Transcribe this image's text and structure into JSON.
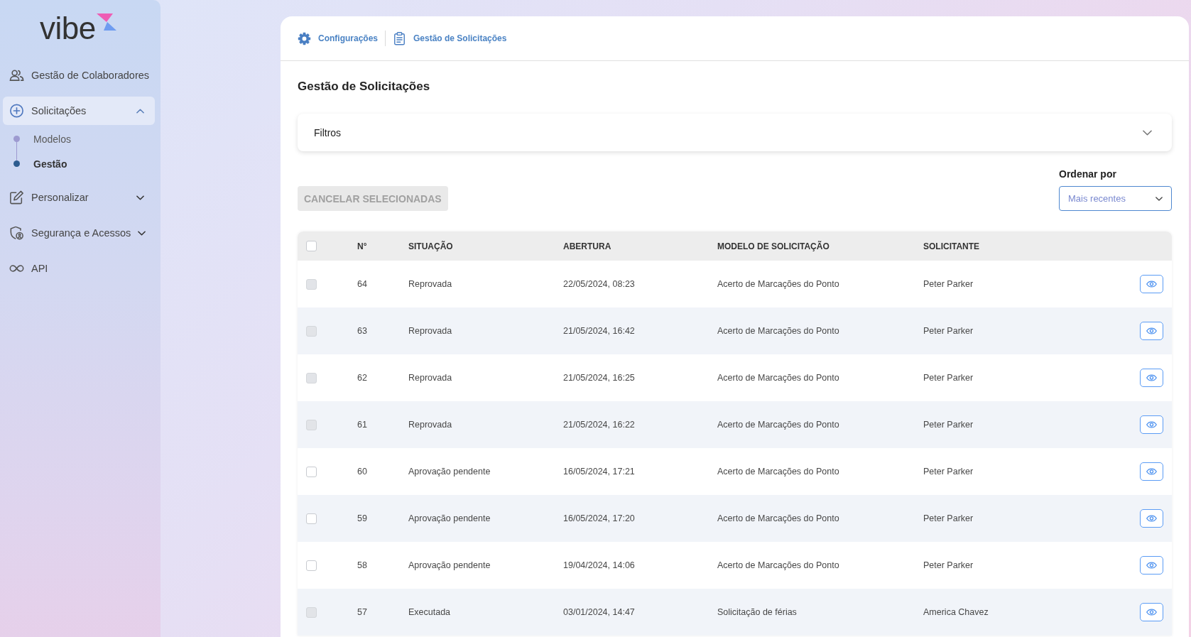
{
  "sidebar": {
    "logo": "vibe",
    "items": [
      {
        "label": "Gestão de Colaboradores",
        "kind": "link",
        "selected": false
      },
      {
        "label": "Solicitações",
        "kind": "group",
        "selected": true,
        "expanded": true,
        "children": [
          {
            "label": "Modelos",
            "selected": false
          },
          {
            "label": "Gestão",
            "selected": true
          }
        ]
      },
      {
        "label": "Personalizar",
        "kind": "group",
        "selected": false,
        "expanded": false
      },
      {
        "label": "Segurança e Acessos",
        "kind": "group",
        "selected": false,
        "expanded": false
      },
      {
        "label": "API",
        "kind": "link",
        "selected": false
      }
    ]
  },
  "breadcrumb": [
    {
      "label": "Configurações"
    },
    {
      "label": "Gestão de Solicitações"
    }
  ],
  "page_title": "Gestão de Solicitações",
  "filters": {
    "label": "Filtros",
    "expanded": false
  },
  "cancel_button": {
    "label": "CANCELAR SELECIONADAS",
    "disabled": true
  },
  "sort": {
    "label": "Ordenar por",
    "value": "Mais recentes"
  },
  "table": {
    "select_all": {
      "checked": false
    },
    "columns": [
      "N°",
      "SITUAÇÃO",
      "ABERTURA",
      "MODELO DE SOLICITAÇÃO",
      "SOLICITANTE"
    ],
    "rows": [
      {
        "number": "64",
        "status": "Reprovada",
        "opened": "22/05/2024, 08:23",
        "model": "Acerto de Marcações do Ponto",
        "requester": "Peter Parker",
        "checked": false,
        "disabled": true
      },
      {
        "number": "63",
        "status": "Reprovada",
        "opened": "21/05/2024, 16:42",
        "model": "Acerto de Marcações do Ponto",
        "requester": "Peter Parker",
        "checked": false,
        "disabled": true
      },
      {
        "number": "62",
        "status": "Reprovada",
        "opened": "21/05/2024, 16:25",
        "model": "Acerto de Marcações do Ponto",
        "requester": "Peter Parker",
        "checked": false,
        "disabled": true
      },
      {
        "number": "61",
        "status": "Reprovada",
        "opened": "21/05/2024, 16:22",
        "model": "Acerto de Marcações do Ponto",
        "requester": "Peter Parker",
        "checked": false,
        "disabled": true
      },
      {
        "number": "60",
        "status": "Aprovação pendente",
        "opened": "16/05/2024, 17:21",
        "model": "Acerto de Marcações do Ponto",
        "requester": "Peter Parker",
        "checked": false,
        "disabled": false
      },
      {
        "number": "59",
        "status": "Aprovação pendente",
        "opened": "16/05/2024, 17:20",
        "model": "Acerto de Marcações do Ponto",
        "requester": "Peter Parker",
        "checked": false,
        "disabled": false
      },
      {
        "number": "58",
        "status": "Aprovação pendente",
        "opened": "19/04/2024, 14:06",
        "model": "Acerto de Marcações do Ponto",
        "requester": "Peter Parker",
        "checked": false,
        "disabled": false
      },
      {
        "number": "57",
        "status": "Executada",
        "opened": "03/01/2024, 14:47",
        "model": "Solicitação de férias",
        "requester": "America Chavez",
        "checked": false,
        "disabled": true
      }
    ]
  }
}
